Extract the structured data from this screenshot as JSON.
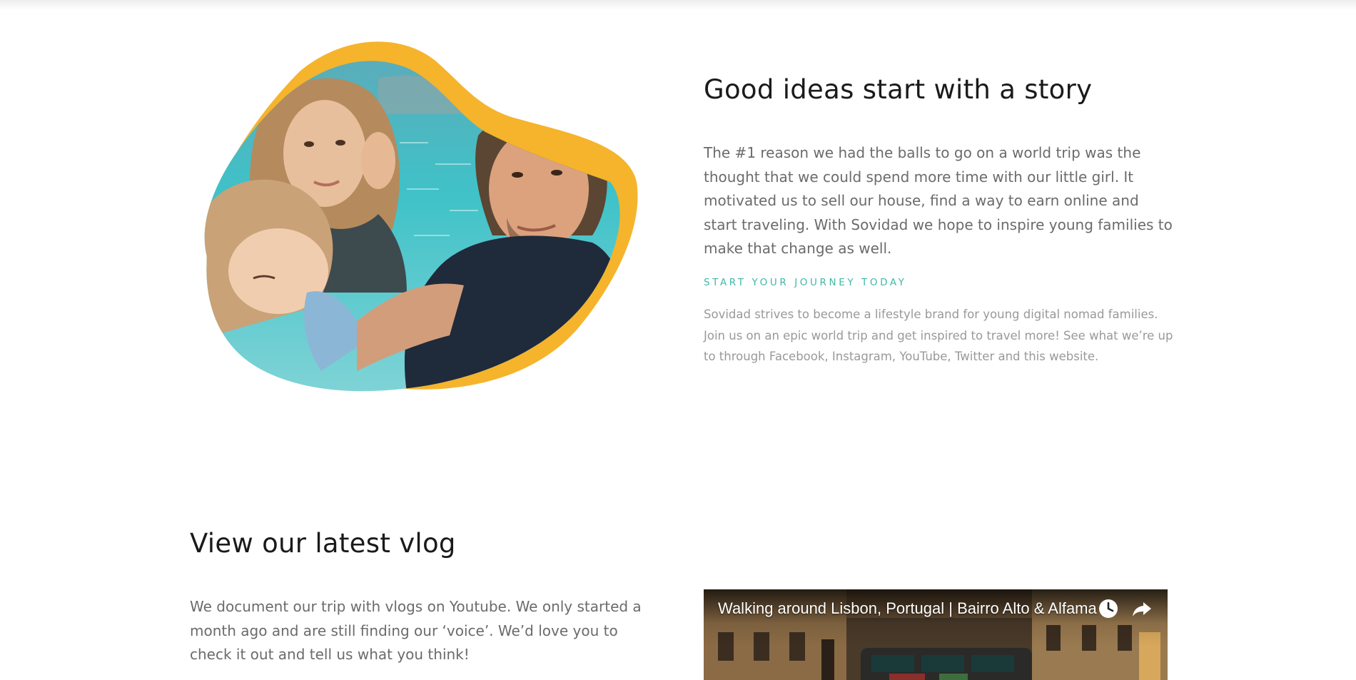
{
  "story": {
    "title": "Good ideas start with a story",
    "body": "The #1 reason we had the balls to go on a world trip was the thought that we could spend more time with our little girl. It motivated us to sell our house, find a way to earn online and start traveling. With Sovidad we hope to inspire young families to make that change as well.",
    "journey_label": "START YOUR JOURNEY TODAY",
    "journey_body": "Sovidad strives to become a lifestyle brand for young digital nomad families. Join us on an epic world trip and get inspired to travel more! See what we’re up to through Facebook, Instagram, YouTube, Twitter and this website."
  },
  "vlog": {
    "title": "View our latest vlog",
    "body": "We document our trip with vlogs on Youtube. We only started a month ago and are still finding our ‘voice’. We’d love you to check it out and tell us what you think!",
    "video": {
      "title": "Walking around Lisbon, Portugal | Bairro Alto & Alfama",
      "watch_later_icon": "clock-icon",
      "share_icon": "share-arrow-icon"
    }
  },
  "colors": {
    "accent_teal": "#3fb8a8",
    "blob_yellow": "#f5b42c",
    "heading": "#1a1a1a",
    "body_text": "#6b6b6b",
    "muted_text": "#999999"
  }
}
